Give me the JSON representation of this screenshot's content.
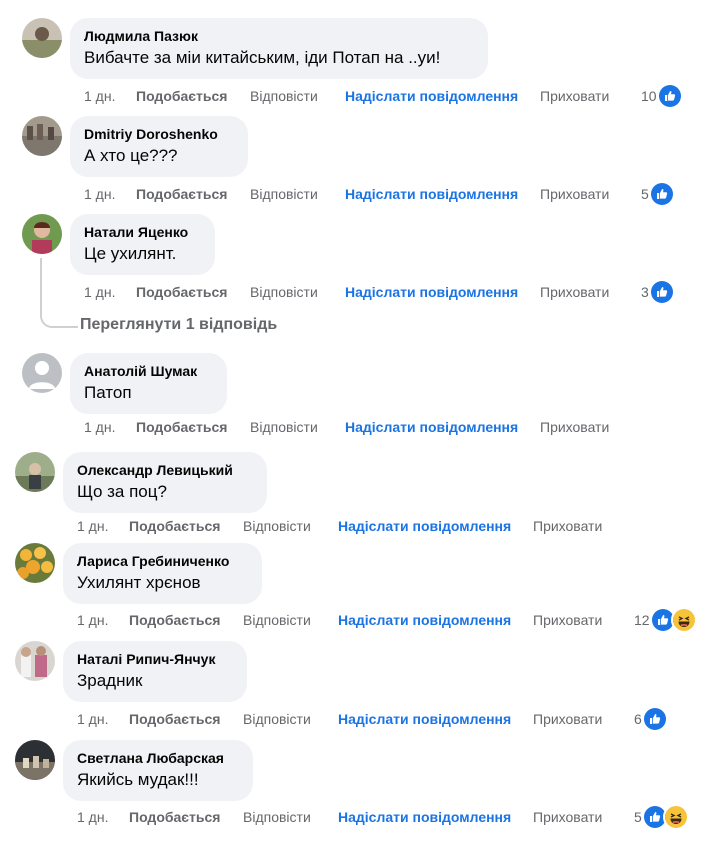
{
  "actions": {
    "like": "Подобається",
    "reply": "Відповісти",
    "message": "Надіслати повідомлення",
    "hide": "Приховати"
  },
  "colors": {
    "like_blue": "#1b74e4",
    "bubble_bg": "#f0f2f5",
    "meta_gray": "#65676b"
  },
  "comments": [
    {
      "author": "Людмила Пазюк",
      "text": "Вибачте за міи китайським, іди Потап на ..уи!",
      "time": "1 дн.",
      "reactions": "10",
      "reaction_icons": [
        "like-icon"
      ]
    },
    {
      "author": "Dmitriy Doroshenko",
      "text": "А хто це???",
      "time": "1 дн.",
      "reactions": "5",
      "reaction_icons": [
        "like-icon"
      ]
    },
    {
      "author": "Натали Яценко",
      "text": "Це ухилянт.",
      "time": "1 дн.",
      "reactions": "3",
      "reaction_icons": [
        "like-icon"
      ]
    },
    {
      "author": "Анатолій Шумак",
      "text": "Патоп",
      "time": "1 дн.",
      "reactions": "",
      "reaction_icons": []
    },
    {
      "author": "Олександр Левицький",
      "text": "Що за поц?",
      "time": "1 дн.",
      "reactions": "",
      "reaction_icons": []
    },
    {
      "author": "Лариса Гребиниченко",
      "text": "Ухилянт хрєнов",
      "time": "1 дн.",
      "reactions": "12",
      "reaction_icons": [
        "like-icon",
        "haha-icon"
      ]
    },
    {
      "author": "Наталі Рипич-Янчук",
      "text": "Зрадник",
      "time": "1 дн.",
      "reactions": "6",
      "reaction_icons": [
        "like-icon"
      ]
    },
    {
      "author": "Светлана Любарская",
      "text": "Якийсь мудак!!!",
      "time": "1 дн.",
      "reactions": "5",
      "reaction_icons": [
        "like-icon",
        "haha-icon"
      ]
    }
  ],
  "thread": {
    "view_replies": "Переглянути 1 відповідь"
  }
}
